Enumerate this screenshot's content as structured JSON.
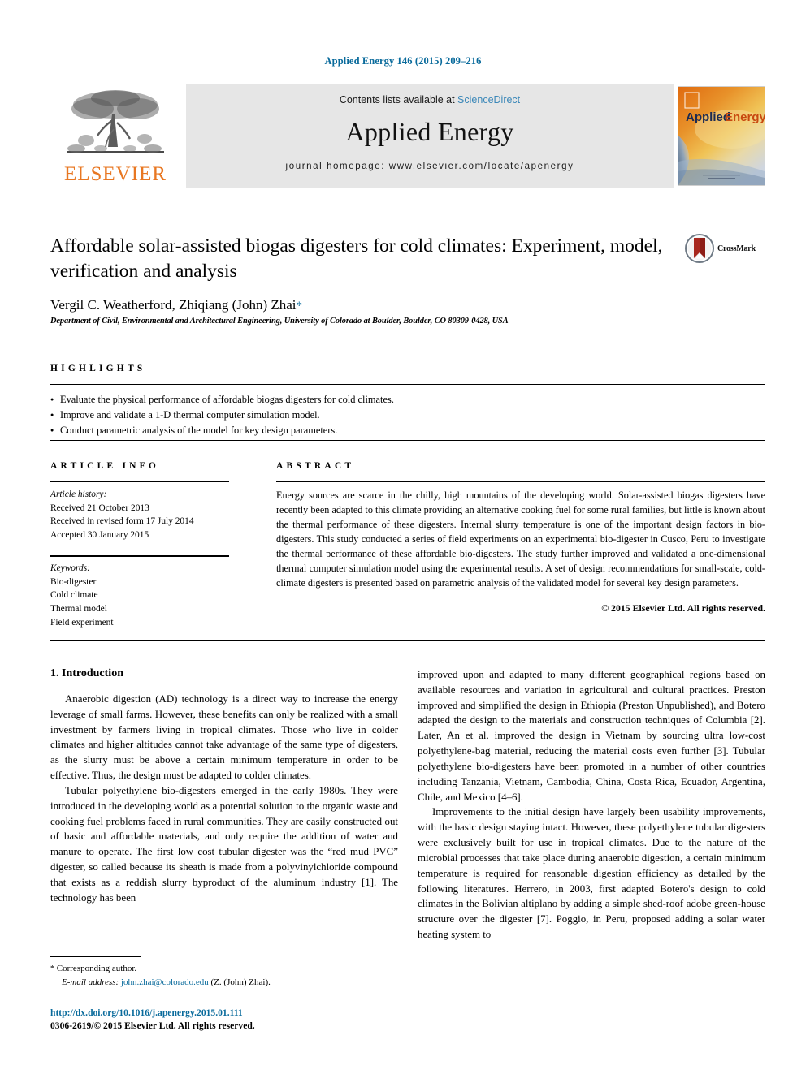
{
  "running_head": "Applied Energy 146 (2015) 209–216",
  "masthead": {
    "publisher_name": "ELSEVIER",
    "contents_prefix": "Contents lists available at ",
    "sciencedirect_link": "ScienceDirect",
    "journal_name": "Applied Energy",
    "homepage_line": "journal homepage: www.elsevier.com/locate/apenergy",
    "cover_title_part1": "Applied",
    "cover_title_part2": "Energy"
  },
  "article": {
    "title": "Affordable solar-assisted biogas digesters for cold climates: Experiment, model, verification and analysis",
    "authors": "Vergil C. Weatherford, Zhiqiang (John) Zhai",
    "corresponding_marker": "*",
    "affiliation": "Department of Civil, Environmental and Architectural Engineering, University of Colorado at Boulder, Boulder, CO 80309-0428, USA",
    "crossmark_label": "CrossMark"
  },
  "highlights": {
    "heading": "HIGHLIGHTS",
    "items": [
      "Evaluate the physical performance of affordable biogas digesters for cold climates.",
      "Improve and validate a 1-D thermal computer simulation model.",
      "Conduct parametric analysis of the model for key design parameters."
    ]
  },
  "article_info": {
    "heading": "ARTICLE INFO",
    "history_label": "Article history:",
    "history": [
      "Received 21 October 2013",
      "Received in revised form 17 July 2014",
      "Accepted 30 January 2015"
    ],
    "keywords_label": "Keywords:",
    "keywords": [
      "Bio-digester",
      "Cold climate",
      "Thermal model",
      "Field experiment"
    ]
  },
  "abstract": {
    "heading": "ABSTRACT",
    "text": "Energy sources are scarce in the chilly, high mountains of the developing world. Solar-assisted biogas digesters have recently been adapted to this climate providing an alternative cooking fuel for some rural families, but little is known about the thermal performance of these digesters. Internal slurry temperature is one of the important design factors in bio-digesters. This study conducted a series of field experiments on an experimental bio-digester in Cusco, Peru to investigate the thermal performance of these affordable bio-digesters. The study further improved and validated a one-dimensional thermal computer simulation model using the experimental results. A set of design recommendations for small-scale, cold-climate digesters is presented based on parametric analysis of the validated model for several key design parameters.",
    "copyright": "© 2015 Elsevier Ltd. All rights reserved."
  },
  "body": {
    "section_title": "1. Introduction",
    "left_paragraphs": [
      "Anaerobic digestion (AD) technology is a direct way to increase the energy leverage of small farms. However, these benefits can only be realized with a small investment by farmers living in tropical climates. Those who live in colder climates and higher altitudes cannot take advantage of the same type of digesters, as the slurry must be above a certain minimum temperature in order to be effective. Thus, the design must be adapted to colder climates.",
      "Tubular polyethylene bio-digesters emerged in the early 1980s. They were introduced in the developing world as a potential solution to the organic waste and cooking fuel problems faced in rural communities. They are easily constructed out of basic and affordable materials, and only require the addition of water and manure to operate. The first low cost tubular digester was the “red mud PVC” digester, so called because its sheath is made from a polyvinylchloride compound that exists as a reddish slurry byproduct of the aluminum industry [1]. The technology has been"
    ],
    "right_paragraphs": [
      "improved upon and adapted to many different geographical regions based on available resources and variation in agricultural and cultural practices. Preston improved and simplified the design in Ethiopia (Preston Unpublished), and Botero adapted the design to the materials and construction techniques of Columbia [2]. Later, An et al. improved the design in Vietnam by sourcing ultra low-cost polyethylene-bag material, reducing the material costs even further [3]. Tubular polyethylene bio-digesters have been promoted in a number of other countries including Tanzania, Vietnam, Cambodia, China, Costa Rica, Ecuador, Argentina, Chile, and Mexico [4–6].",
      "Improvements to the initial design have largely been usability improvements, with the basic design staying intact. However, these polyethylene tubular digesters were exclusively built for use in tropical climates. Due to the nature of the microbial processes that take place during anaerobic digestion, a certain minimum temperature is required for reasonable digestion efficiency as detailed by the following literatures. Herrero, in 2003, first adapted Botero's design to cold climates in the Bolivian altiplano by adding a simple shed-roof adobe green-house structure over the digester [7]. Poggio, in Peru, proposed adding a solar water heating system to"
    ]
  },
  "footer": {
    "corresponding_star": "*",
    "corresponding_text": "Corresponding author.",
    "email_label": "E-mail address:",
    "email": "john.zhai@colorado.edu",
    "email_suffix": "(Z. (John) Zhai).",
    "doi_url": "http://dx.doi.org/10.1016/j.apenergy.2015.01.111",
    "issn_line": "0306-2619/© 2015 Elsevier Ltd. All rights reserved."
  },
  "colors": {
    "link_blue": "#0a6b9c",
    "sciencedirect_blue": "#3a87b8",
    "elsevier_orange": "#E87722",
    "band_gray": "#e6e6e6"
  }
}
